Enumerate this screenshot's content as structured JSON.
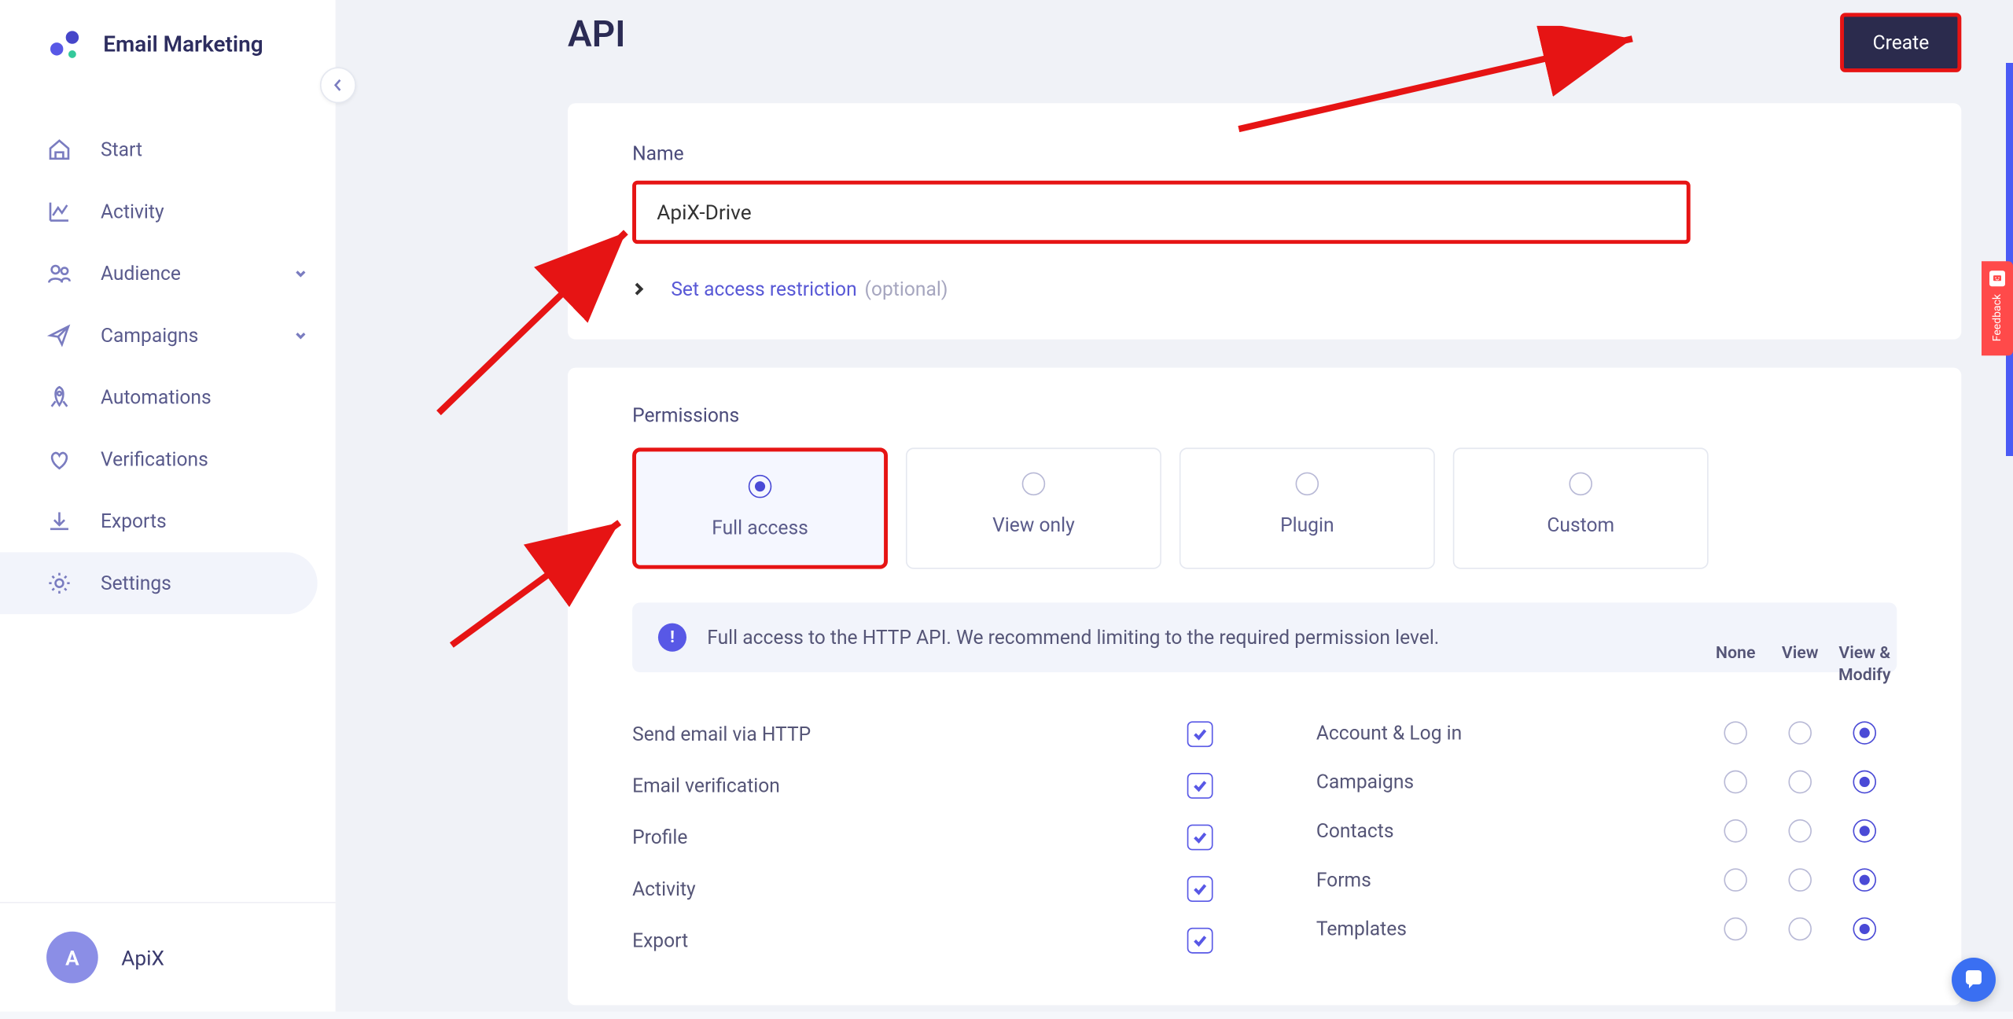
{
  "brand": "Email Marketing",
  "sidebar": {
    "items": [
      {
        "label": "Start",
        "icon": "home"
      },
      {
        "label": "Activity",
        "icon": "chart"
      },
      {
        "label": "Audience",
        "icon": "users",
        "expandable": true
      },
      {
        "label": "Campaigns",
        "icon": "send",
        "expandable": true
      },
      {
        "label": "Automations",
        "icon": "rocket"
      },
      {
        "label": "Verifications",
        "icon": "heart"
      },
      {
        "label": "Exports",
        "icon": "download"
      },
      {
        "label": "Settings",
        "icon": "gear",
        "active": true
      }
    ]
  },
  "account": {
    "initial": "A",
    "name": "ApiX"
  },
  "page": {
    "title": "API",
    "create_label": "Create",
    "name_label": "Name",
    "name_value": "ApiX-Drive",
    "access_link": "Set access restriction",
    "optional": "(optional)",
    "permissions_label": "Permissions",
    "perm_options": [
      {
        "label": "Full access",
        "selected": true
      },
      {
        "label": "View only",
        "selected": false
      },
      {
        "label": "Plugin",
        "selected": false
      },
      {
        "label": "Custom",
        "selected": false
      }
    ],
    "info_text": "Full access to the HTTP API. We recommend limiting to the required permission level.",
    "perm_headers": [
      "None",
      "View",
      "View & Modify"
    ],
    "perm_left": [
      {
        "name": "Send email via HTTP",
        "checked": true
      },
      {
        "name": "Email verification",
        "checked": true
      },
      {
        "name": "Profile",
        "checked": true
      },
      {
        "name": "Activity",
        "checked": true
      },
      {
        "name": "Export",
        "checked": true
      }
    ],
    "perm_right": [
      {
        "name": "Account & Log in",
        "value": 2
      },
      {
        "name": "Campaigns",
        "value": 2
      },
      {
        "name": "Contacts",
        "value": 2
      },
      {
        "name": "Forms",
        "value": 2
      },
      {
        "name": "Templates",
        "value": 2
      }
    ]
  },
  "feedback_label": "Feedback"
}
